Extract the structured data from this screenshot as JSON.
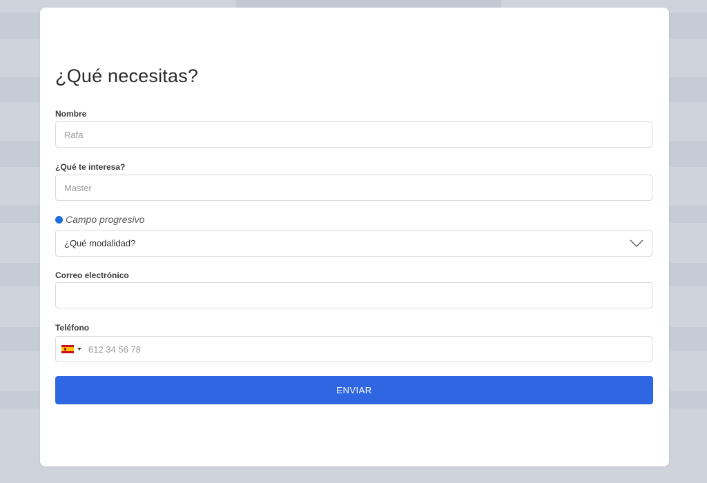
{
  "form": {
    "title": "¿Qué necesitas?",
    "fields": {
      "nombre": {
        "label": "Nombre",
        "placeholder": "Rafa",
        "value": ""
      },
      "interes": {
        "label": "¿Qué te interesa?",
        "placeholder": "Master",
        "value": ""
      },
      "modalidad": {
        "label": "Campo progresivo",
        "selected": "¿Qué modalidad?",
        "icon": "chevron-down-icon",
        "dot_color": "#1f6be0"
      },
      "email": {
        "label": "Correo electrónico",
        "placeholder": "",
        "value": ""
      },
      "telefono": {
        "label": "Teléfono",
        "placeholder": "612 34 56 78",
        "country_flag": "spain-flag-icon",
        "value": ""
      }
    },
    "submit_label": "ENVIAR"
  },
  "colors": {
    "accent": "#2f67e3",
    "page_background": "#ced3dc",
    "card_background": "#ffffff"
  }
}
